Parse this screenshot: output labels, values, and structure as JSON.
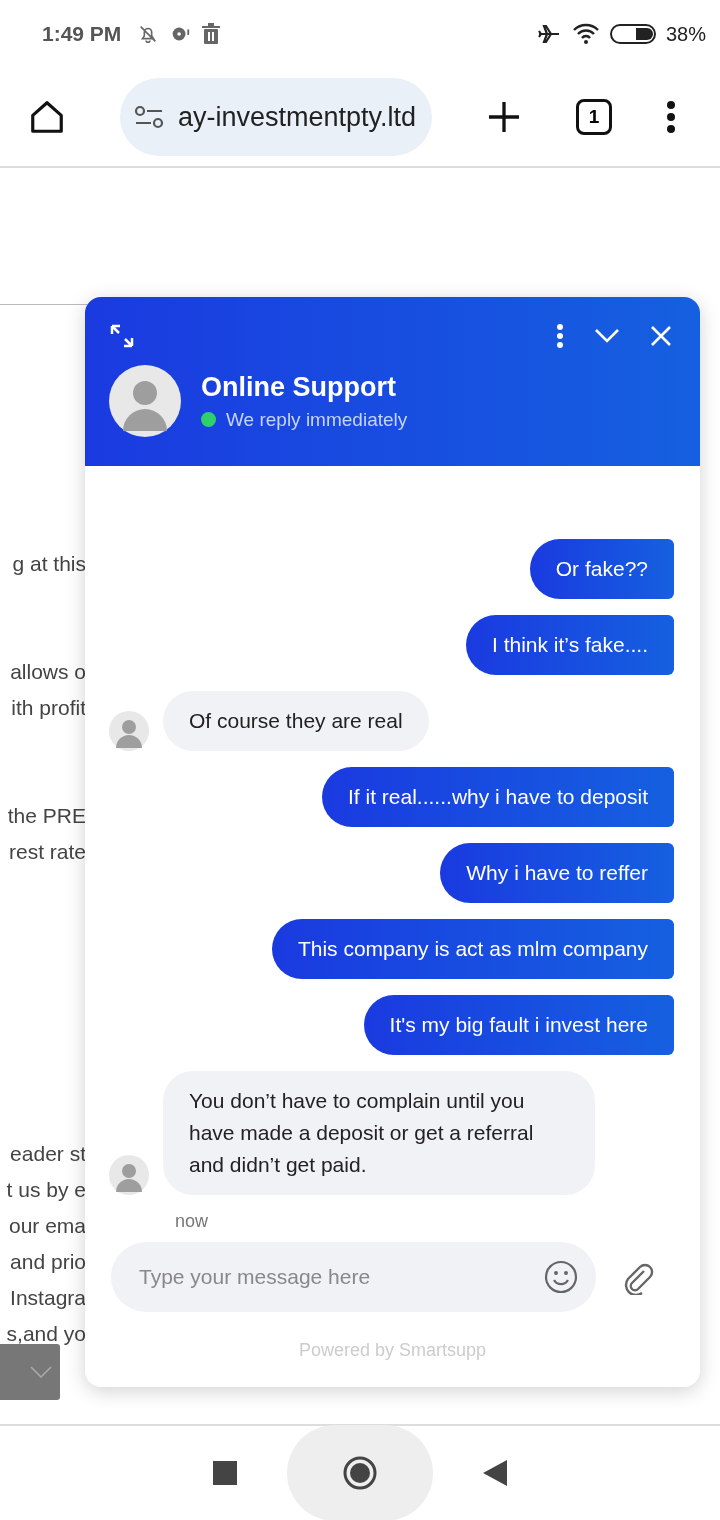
{
  "status_bar": {
    "time": "1:49 PM",
    "battery": "38%"
  },
  "browser": {
    "url": "ay-investmentpty.ltd",
    "tab_count": "1"
  },
  "page_text": [
    [
      "g at this"
    ],
    [
      "allows o",
      "ith profit"
    ],
    [
      "the PRE",
      "rest rate"
    ],
    [
      "eader st",
      "t us by e",
      "our ema",
      "and prio",
      "Instagra",
      "s,and yo"
    ]
  ],
  "chat": {
    "title": "Online Support",
    "status": "We reply immediately",
    "online": true,
    "messages": [
      {
        "kind": "sent",
        "text": "Or fake??"
      },
      {
        "kind": "sent",
        "text": "I think it’s fake...."
      },
      {
        "kind": "received",
        "text": "Of course they are real"
      },
      {
        "kind": "sent",
        "text": "If it real......why i have to deposit"
      },
      {
        "kind": "sent",
        "text": "Why i have to reffer"
      },
      {
        "kind": "sent",
        "text": "This company is act as mlm company"
      },
      {
        "kind": "sent",
        "text": "It's my big fault i invest here"
      },
      {
        "kind": "received",
        "text": "You don’t have to complain until you have made a deposit or get a referral and didn’t get paid."
      }
    ],
    "time": "now",
    "placeholder": "Type your message here",
    "footer": "Powered by Smartsupp"
  }
}
